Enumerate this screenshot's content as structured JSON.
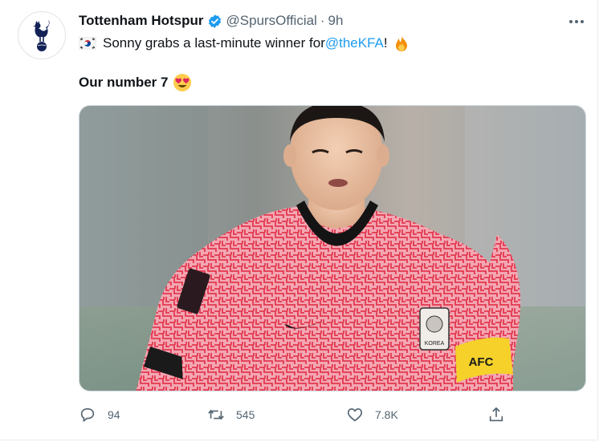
{
  "tweet": {
    "display_name": "Tottenham Hotspur",
    "handle": "@SpursOfficial",
    "separator": "·",
    "time": "9h",
    "text_pre": "Sonny grabs a last-minute winner for ",
    "mention": "@theKFA",
    "text_post": "!",
    "line2": "Our number 7",
    "image_alt": "Son Heung-min in South Korea's red and pink patterned home shirt",
    "shirt_crest_text": "KOREA",
    "armband_text": "AFC"
  },
  "actions": {
    "reply_count": "94",
    "retweet_count": "545",
    "like_count": "7.8K"
  },
  "icons": {
    "verified": "verified-badge-icon",
    "more": "more-horizontal-icon",
    "reply": "reply-icon",
    "retweet": "retweet-icon",
    "like": "heart-icon",
    "share": "share-icon"
  },
  "colors": {
    "link": "#1d9bf0",
    "secondary_text": "#536471",
    "primary_text": "#0f1419",
    "club_navy": "#132257"
  }
}
